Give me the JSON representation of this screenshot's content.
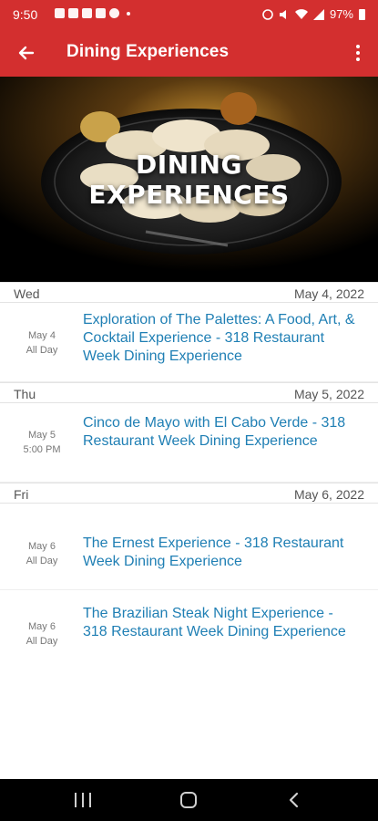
{
  "status_bar": {
    "time": "9:50",
    "battery": "97%",
    "icons": [
      "notification-icon",
      "nfl-icon",
      "youtube-icon",
      "youtube-icon",
      "reddit-icon",
      "mute-icon",
      "wifi-icon",
      "signal-icon"
    ]
  },
  "app_bar": {
    "title": "Dining Experiences",
    "back_icon": "arrow-left-icon",
    "menu_icon": "more-vert-icon"
  },
  "hero": {
    "line1": "DINING",
    "line2": "EXPERIENCES"
  },
  "days": [
    {
      "day": "Wed",
      "date": "May 4, 2022",
      "events": [
        {
          "date": "May 4",
          "time": "All Day",
          "title": "Exploration of The Palettes: A Food, Art, & Cocktail Experience - 318 Restaurant Week Dining Experience"
        }
      ]
    },
    {
      "day": "Thu",
      "date": "May 5, 2022",
      "events": [
        {
          "date": "May 5",
          "time": "5:00 PM",
          "title": "Cinco de Mayo with El Cabo Verde - 318 Restaurant Week Dining Experience"
        }
      ]
    },
    {
      "day": "Fri",
      "date": "May 6, 2022",
      "events": [
        {
          "date": "May 6",
          "time": "All Day",
          "title": "The Ernest Experience - 318 Restaurant Week Dining Experience"
        },
        {
          "date": "May 6",
          "time": "All Day",
          "title": "The Brazilian Steak Night Experience - 318 Restaurant Week Dining Experience"
        }
      ]
    }
  ],
  "colors": {
    "primary": "#d32f2f",
    "link": "#1f7fb4",
    "muted": "#777777"
  },
  "nav_bar": {
    "icons": [
      "recent-apps-icon",
      "home-icon",
      "back-icon"
    ]
  }
}
